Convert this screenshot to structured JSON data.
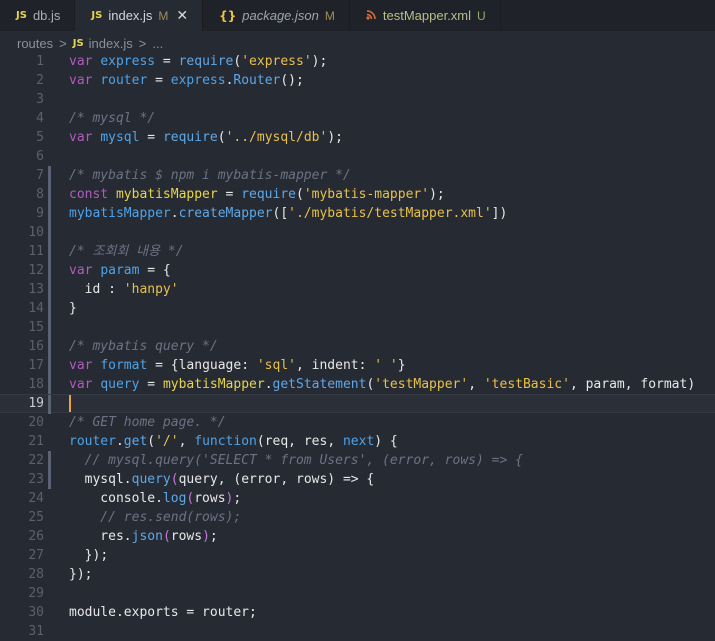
{
  "tabs": [
    {
      "icon": "JS",
      "label": "db.js",
      "status": "",
      "active": false
    },
    {
      "icon": "JS",
      "label": "index.js",
      "status": "M",
      "active": true,
      "close": "✕"
    },
    {
      "icon": "{}",
      "label": "package.json",
      "status": "M",
      "active": false
    },
    {
      "icon": "rss",
      "label": "testMapper.xml",
      "status": "U",
      "active": false
    }
  ],
  "breadcrumb": {
    "folder": "routes",
    "sep1": ">",
    "icon": "JS",
    "file": "index.js",
    "sep2": ">",
    "more": "..."
  },
  "editor": {
    "current_line": 19,
    "lines": [
      {
        "n": "1",
        "m": false,
        "tokens": [
          [
            "kw",
            "var"
          ],
          [
            "p",
            " "
          ],
          [
            "var",
            "express"
          ],
          [
            "p",
            " = "
          ],
          [
            "fn",
            "require"
          ],
          [
            "p",
            "("
          ],
          [
            "str",
            "'express'"
          ],
          [
            "p",
            ");"
          ]
        ]
      },
      {
        "n": "2",
        "m": false,
        "tokens": [
          [
            "kw",
            "var"
          ],
          [
            "p",
            " "
          ],
          [
            "var",
            "router"
          ],
          [
            "p",
            " = "
          ],
          [
            "var",
            "express"
          ],
          [
            "p",
            "."
          ],
          [
            "fn",
            "Router"
          ],
          [
            "p",
            "();"
          ]
        ]
      },
      {
        "n": "3",
        "m": false,
        "tokens": []
      },
      {
        "n": "4",
        "m": false,
        "tokens": [
          [
            "cm",
            "/* mysql */"
          ]
        ]
      },
      {
        "n": "5",
        "m": false,
        "tokens": [
          [
            "kw",
            "var"
          ],
          [
            "p",
            " "
          ],
          [
            "var",
            "mysql"
          ],
          [
            "p",
            " = "
          ],
          [
            "fn",
            "require"
          ],
          [
            "p",
            "("
          ],
          [
            "str",
            "'../mysql/db'"
          ],
          [
            "p",
            ");"
          ]
        ]
      },
      {
        "n": "6",
        "m": false,
        "tokens": []
      },
      {
        "n": "7",
        "m": true,
        "tokens": [
          [
            "cm",
            "/* mybatis $ npm i mybatis-mapper */"
          ]
        ]
      },
      {
        "n": "8",
        "m": true,
        "tokens": [
          [
            "kw",
            "const"
          ],
          [
            "p",
            " "
          ],
          [
            "p1",
            "mybatisMapper"
          ],
          [
            "p",
            " = "
          ],
          [
            "fn",
            "require"
          ],
          [
            "p",
            "("
          ],
          [
            "str",
            "'mybatis-mapper'"
          ],
          [
            "p",
            ");"
          ]
        ]
      },
      {
        "n": "9",
        "m": true,
        "tokens": [
          [
            "var",
            "mybatisMapper"
          ],
          [
            "p",
            "."
          ],
          [
            "fn",
            "createMapper"
          ],
          [
            "p",
            "(["
          ],
          [
            "str",
            "'./mybatis/testMapper.xml'"
          ],
          [
            "p",
            "])"
          ]
        ]
      },
      {
        "n": "10",
        "m": true,
        "tokens": []
      },
      {
        "n": "11",
        "m": true,
        "tokens": [
          [
            "cm",
            "/* 조회회 내용 */"
          ]
        ]
      },
      {
        "n": "12",
        "m": true,
        "tokens": [
          [
            "kw",
            "var"
          ],
          [
            "p",
            " "
          ],
          [
            "var",
            "param"
          ],
          [
            "p",
            " = {"
          ]
        ]
      },
      {
        "n": "13",
        "m": true,
        "tokens": [
          [
            "p",
            "  id : "
          ],
          [
            "str",
            "'hanpy'"
          ]
        ]
      },
      {
        "n": "14",
        "m": true,
        "tokens": [
          [
            "p",
            "}"
          ]
        ]
      },
      {
        "n": "15",
        "m": true,
        "tokens": []
      },
      {
        "n": "16",
        "m": true,
        "tokens": [
          [
            "cm",
            "/* mybatis query */"
          ]
        ]
      },
      {
        "n": "17",
        "m": true,
        "tokens": [
          [
            "kw",
            "var"
          ],
          [
            "p",
            " "
          ],
          [
            "var",
            "format"
          ],
          [
            "p",
            " = {language: "
          ],
          [
            "str",
            "'sql'"
          ],
          [
            "p",
            ", indent: "
          ],
          [
            "str",
            "' '"
          ],
          [
            "p",
            "}"
          ]
        ]
      },
      {
        "n": "18",
        "m": true,
        "tokens": [
          [
            "kw",
            "var"
          ],
          [
            "p",
            " "
          ],
          [
            "var",
            "query"
          ],
          [
            "p",
            " = "
          ],
          [
            "p1",
            "mybatisMapper"
          ],
          [
            "p",
            "."
          ],
          [
            "fn",
            "getStatement"
          ],
          [
            "p",
            "("
          ],
          [
            "str",
            "'testMapper'"
          ],
          [
            "p",
            ", "
          ],
          [
            "str",
            "'testBasic'"
          ],
          [
            "p",
            ", param, format)"
          ]
        ]
      },
      {
        "n": "19",
        "m": true,
        "tokens": []
      },
      {
        "n": "20",
        "m": false,
        "tokens": [
          [
            "cm",
            "/* GET home page. */"
          ]
        ]
      },
      {
        "n": "21",
        "m": false,
        "tokens": [
          [
            "var",
            "router"
          ],
          [
            "p",
            "."
          ],
          [
            "fn",
            "get"
          ],
          [
            "p",
            "("
          ],
          [
            "str",
            "'/'"
          ],
          [
            "p",
            ", "
          ],
          [
            "var",
            "function"
          ],
          [
            "p",
            "(req, res, "
          ],
          [
            "var",
            "next"
          ],
          [
            "p",
            ") {"
          ]
        ]
      },
      {
        "n": "22",
        "m": true,
        "tokens": [
          [
            "cm",
            "  // mysql.query('SELECT * from Users', (error, rows) => {"
          ]
        ]
      },
      {
        "n": "23",
        "m": true,
        "tokens": [
          [
            "p",
            "  mysql."
          ],
          [
            "fn",
            "query"
          ],
          [
            "p2",
            "("
          ],
          [
            "p",
            "query, (error, rows) => {"
          ]
        ]
      },
      {
        "n": "24",
        "m": false,
        "tokens": [
          [
            "p",
            "    console."
          ],
          [
            "fn",
            "log"
          ],
          [
            "p2",
            "("
          ],
          [
            "p",
            "rows"
          ],
          [
            "p2",
            ")"
          ],
          [
            "p",
            ";"
          ]
        ]
      },
      {
        "n": "25",
        "m": false,
        "tokens": [
          [
            "cm",
            "    // res.send(rows);"
          ]
        ]
      },
      {
        "n": "26",
        "m": false,
        "tokens": [
          [
            "p",
            "    res."
          ],
          [
            "fn",
            "json"
          ],
          [
            "p2",
            "("
          ],
          [
            "p",
            "rows"
          ],
          [
            "p2",
            ")"
          ],
          [
            "p",
            ";"
          ]
        ]
      },
      {
        "n": "27",
        "m": false,
        "tokens": [
          [
            "p",
            "  })"
          ],
          [
            "p",
            ";"
          ]
        ]
      },
      {
        "n": "28",
        "m": false,
        "tokens": [
          [
            "p",
            "});"
          ]
        ]
      },
      {
        "n": "29",
        "m": false,
        "tokens": []
      },
      {
        "n": "30",
        "m": false,
        "tokens": [
          [
            "p",
            "module.exports = router;"
          ]
        ]
      },
      {
        "n": "31",
        "m": false,
        "tokens": []
      }
    ]
  }
}
